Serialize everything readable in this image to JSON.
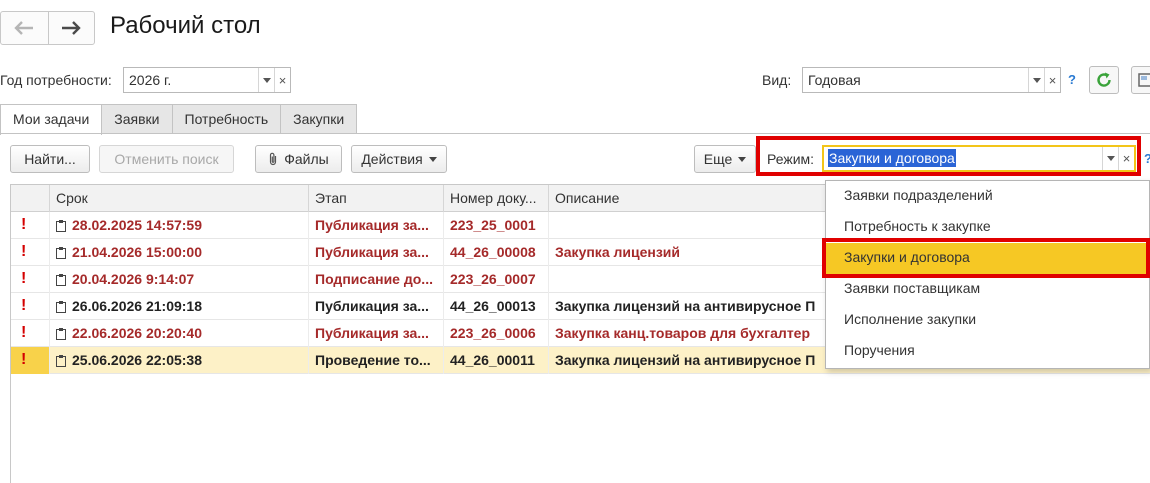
{
  "window": {
    "title": "Рабочий стол"
  },
  "nav": {
    "back_icon": "arrow-left-icon",
    "forward_icon": "arrow-right-icon"
  },
  "filters": {
    "year_label": "Год потребности:",
    "year_value": "2026 г.",
    "view_label": "Вид:",
    "view_value": "Годовая",
    "help": "?",
    "clear": "×"
  },
  "tabs": [
    {
      "label": "Мои задачи",
      "active": true
    },
    {
      "label": "Заявки",
      "active": false
    },
    {
      "label": "Потребность",
      "active": false
    },
    {
      "label": "Закупки",
      "active": false
    }
  ],
  "toolbar": {
    "find_label": "Найти...",
    "cancel_search_label": "Отменить поиск",
    "files_label": "Файлы",
    "actions_label": "Действия",
    "more_label": "Еще",
    "mode_label": "Режим:",
    "mode_value": "Закупки и договора"
  },
  "table": {
    "columns": [
      "",
      "Срок",
      "Этап",
      "Номер доку...",
      "Описание"
    ],
    "rows": [
      {
        "flag": "!",
        "date": "28.02.2025 14:57:59",
        "stage": "Публикация за...",
        "number": "223_25_0001",
        "description": "",
        "style": "red",
        "selected": false
      },
      {
        "flag": "!",
        "date": "21.04.2026 15:00:00",
        "stage": "Публикация за...",
        "number": "44_26_00008",
        "description": "Закупка лицензий",
        "style": "red",
        "selected": false
      },
      {
        "flag": "!",
        "date": "20.04.2026 9:14:07",
        "stage": "Подписание до...",
        "number": "223_26_0007",
        "description": "",
        "style": "red",
        "selected": false
      },
      {
        "flag": "!",
        "date": "26.06.2026 21:09:18",
        "stage": "Публикация за...",
        "number": "44_26_00013",
        "description": "Закупка лицензий на антивирусное П",
        "style": "black",
        "selected": false
      },
      {
        "flag": "!",
        "date": "22.06.2026 20:20:40",
        "stage": "Публикация за...",
        "number": "223_26_0006",
        "description": "Закупка канц.товаров для бухгалтер",
        "style": "red",
        "selected": false
      },
      {
        "flag": "!",
        "date": "25.06.2026 22:05:38",
        "stage": "Проведение то...",
        "number": "44_26_00011",
        "description": "Закупка лицензий на антивирусное П",
        "style": "black",
        "selected": true
      }
    ]
  },
  "mode_dropdown": {
    "items": [
      {
        "label": "Заявки подразделений",
        "highlighted": false
      },
      {
        "label": "Потребность к закупке",
        "highlighted": false
      },
      {
        "label": "Закупки и договора",
        "highlighted": true
      },
      {
        "label": "Заявки поставщикам",
        "highlighted": false
      },
      {
        "label": "Исполнение закупки",
        "highlighted": false
      },
      {
        "label": "Поручения",
        "highlighted": false
      }
    ]
  },
  "colors": {
    "accent_red": "#e00000",
    "selection": "#f6c824",
    "row_selected": "#fdf1c7",
    "overdue_text": "#a52a2a",
    "refresh_green": "#3aa33a",
    "help_blue": "#2a7ad2"
  }
}
